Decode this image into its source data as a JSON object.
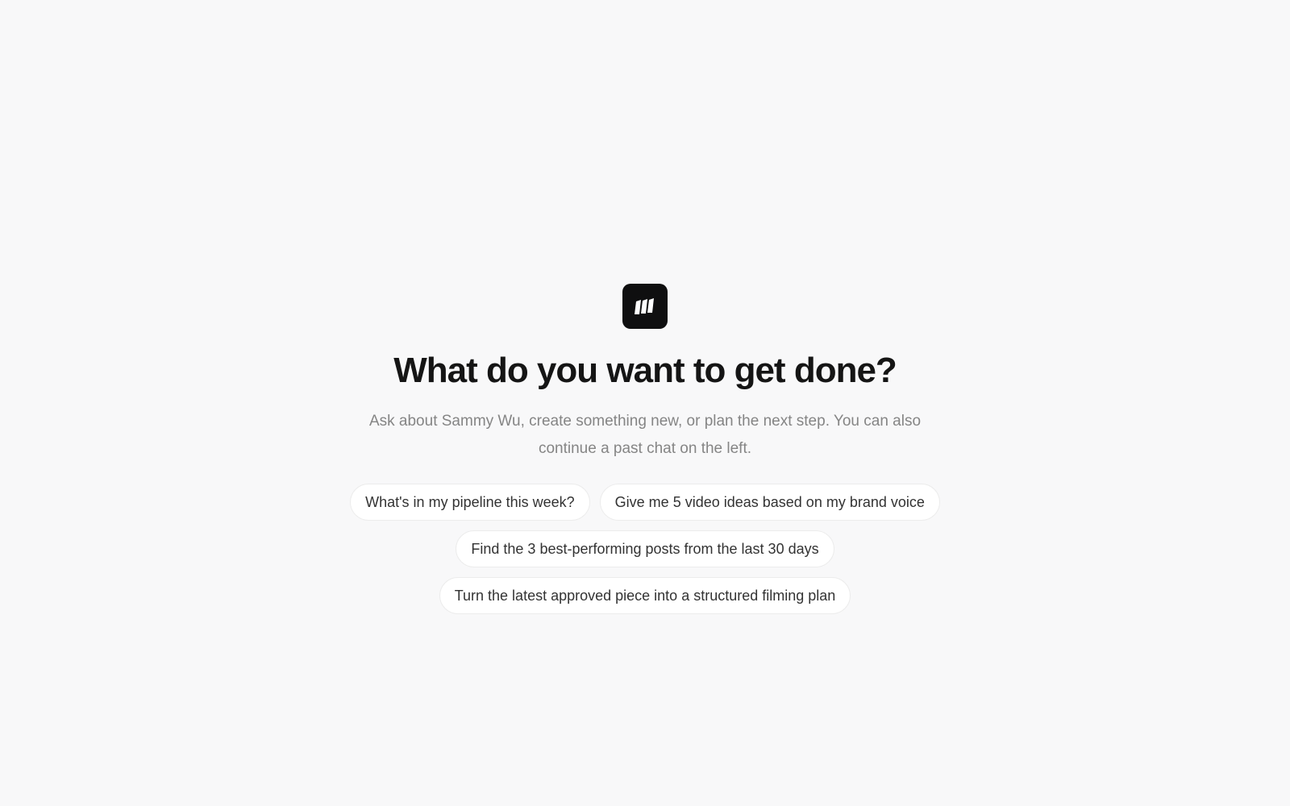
{
  "brand": {
    "logo_icon": "brand-logo-icon",
    "accent": "#0f0f10"
  },
  "hero": {
    "title": "What do you want to get done?",
    "subtitle": "Ask about Sammy Wu, create something new, or plan the next step. You can also continue a past chat on the left."
  },
  "suggestions": [
    "What's in my pipeline this week?",
    "Give me 5 video ideas based on my brand voice",
    "Find the 3 best-performing posts from the last 30 days",
    "Turn the latest approved piece into a structured filming plan"
  ],
  "colors": {
    "background": "#f8f8f9",
    "title": "#151515",
    "subtitle": "#858585",
    "chip_bg": "#ffffff",
    "chip_border": "#ececec"
  }
}
